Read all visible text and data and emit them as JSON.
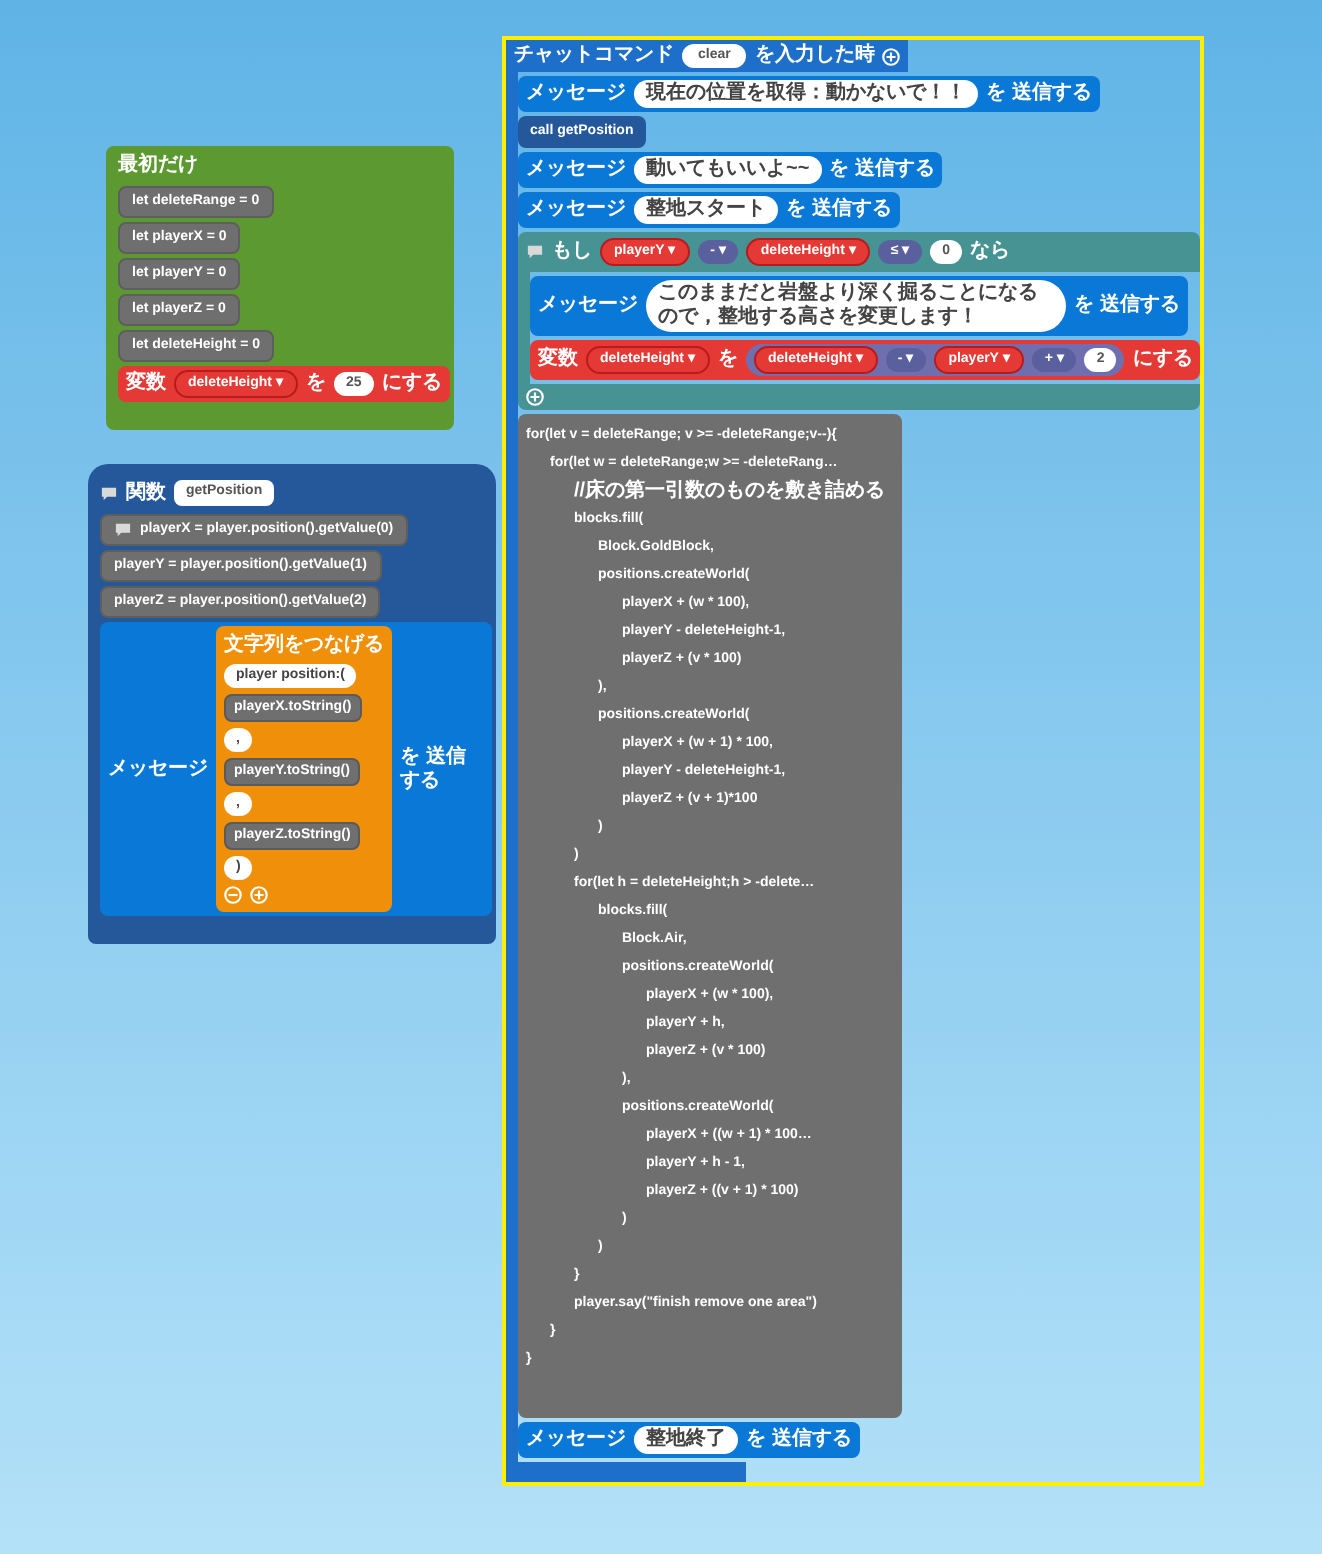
{
  "on_start": {
    "title": "最初だけ",
    "statements": [
      {
        "kind": "js",
        "text": "let deleteRange = 0",
        "comment": false
      },
      {
        "kind": "js",
        "text": "let playerX = 0",
        "comment": false
      },
      {
        "kind": "js",
        "text": "let playerY = 0",
        "comment": false
      },
      {
        "kind": "js",
        "text": "let playerZ = 0",
        "comment": false
      },
      {
        "kind": "js",
        "text": "let deleteHeight = 0",
        "comment": false
      },
      {
        "kind": "set",
        "label": "変数",
        "variable": "deleteHeight ▾",
        "to": "を",
        "value": {
          "kind": "num",
          "text": "25"
        },
        "suffix": "にする"
      }
    ]
  },
  "function": {
    "label": "関数",
    "name": "getPosition",
    "statements": [
      {
        "kind": "js",
        "text": "playerX = player.position().getValue(0)",
        "comment": true
      },
      {
        "kind": "js",
        "text": "playerY = player.position().getValue(1)",
        "comment": false
      },
      {
        "kind": "js",
        "text": "playerZ = player.position().getValue(2)",
        "comment": false
      },
      {
        "kind": "message",
        "label": "メッセージ",
        "value": {
          "kind": "join",
          "title": "文字列をつなげる",
          "items": [
            {
              "kind": "text",
              "text": "player position:("
            },
            {
              "kind": "code",
              "text": "playerX.toString()"
            },
            {
              "kind": "text",
              "text": ","
            },
            {
              "kind": "code",
              "text": "playerY.toString()"
            },
            {
              "kind": "text",
              "text": ","
            },
            {
              "kind": "code",
              "text": "playerZ.toString()"
            },
            {
              "kind": "text",
              "text": ")"
            }
          ]
        },
        "suffix": "を 送信する"
      }
    ]
  },
  "chat_command": {
    "selected": true,
    "label": "チャットコマンド",
    "command": "clear",
    "suffix": "を入力した時",
    "statements": [
      {
        "kind": "message",
        "label": "メッセージ",
        "value": {
          "kind": "text",
          "text": "現在の位置を取得：動かないで！！"
        },
        "suffix": "を 送信する"
      },
      {
        "kind": "call",
        "text": "call getPosition"
      },
      {
        "kind": "message",
        "label": "メッセージ",
        "value": {
          "kind": "text",
          "text": "動いてもいいよ~~"
        },
        "suffix": "を 送信する"
      },
      {
        "kind": "message",
        "label": "メッセージ",
        "value": {
          "kind": "text",
          "text": "整地スタート"
        },
        "suffix": "を 送信する"
      },
      {
        "kind": "if",
        "label": "もし",
        "condition": [
          {
            "kind": "var",
            "text": "playerY ▾"
          },
          {
            "kind": "op",
            "text": "- ▾"
          },
          {
            "kind": "var",
            "text": "deleteHeight ▾"
          },
          {
            "kind": "op",
            "text": "≤ ▾"
          },
          {
            "kind": "num",
            "text": "0"
          }
        ],
        "then": "なら",
        "body": [
          {
            "kind": "message",
            "label": "メッセージ",
            "value": {
              "kind": "text",
              "text": "このままだと岩盤より深く掘ることになるので，整地する高さを変更します！"
            },
            "suffix": "を 送信する"
          },
          {
            "kind": "set",
            "label": "変数",
            "variable": "deleteHeight ▾",
            "to": "を",
            "value": {
              "kind": "expression",
              "parts": [
                {
                  "kind": "var",
                  "text": "deleteHeight ▾"
                },
                {
                  "kind": "op",
                  "text": "- ▾"
                },
                {
                  "kind": "var",
                  "text": "playerY ▾"
                },
                {
                  "kind": "op",
                  "text": "+ ▾"
                },
                {
                  "kind": "num",
                  "text": "2"
                }
              ]
            },
            "suffix": "にする"
          }
        ]
      },
      {
        "kind": "code",
        "lines": [
          {
            "text": "for(let v = deleteRange; v >= -deleteRange;v--){",
            "children": [
              {
                "text": "for(let w = deleteRange;w >= -deleteRang…",
                "children": [
                  {
                    "kind": "comment",
                    "text": "//床の第一引数のものを敷き詰める"
                  },
                  {
                    "text": "blocks.fill(",
                    "children": [
                      {
                        "text": "Block.GoldBlock,"
                      },
                      {
                        "text": "positions.createWorld(",
                        "children": [
                          {
                            "text": "playerX + (w * 100),"
                          },
                          {
                            "text": "playerY - deleteHeight-1,"
                          },
                          {
                            "text": "playerZ + (v * 100)"
                          }
                        ]
                      },
                      {
                        "text": "),"
                      },
                      {
                        "text": "positions.createWorld(",
                        "children": [
                          {
                            "text": "playerX + (w + 1) * 100,"
                          },
                          {
                            "text": "playerY - deleteHeight-1,"
                          },
                          {
                            "text": "playerZ + (v + 1)*100"
                          }
                        ]
                      },
                      {
                        "text": ")"
                      }
                    ]
                  },
                  {
                    "text": ")"
                  },
                  {
                    "text": "for(let h = deleteHeight;h > -delete…",
                    "children": [
                      {
                        "text": "blocks.fill(",
                        "children": [
                          {
                            "text": "Block.Air,"
                          },
                          {
                            "text": "positions.createWorld(",
                            "children": [
                              {
                                "text": "playerX + (w * 100),"
                              },
                              {
                                "text": "playerY +  h,"
                              },
                              {
                                "text": "playerZ + (v * 100)"
                              }
                            ]
                          },
                          {
                            "text": "),"
                          },
                          {
                            "text": "positions.createWorld(",
                            "children": [
                              {
                                "text": "playerX + ((w + 1) * 100…"
                              },
                              {
                                "text": "playerY + h - 1,"
                              },
                              {
                                "text": "playerZ + ((v + 1) * 100)"
                              }
                            ]
                          },
                          {
                            "text": ")"
                          }
                        ]
                      },
                      {
                        "text": ")"
                      }
                    ]
                  },
                  {
                    "text": "}"
                  },
                  {
                    "text": "player.say(\"finish remove one area\")"
                  }
                ]
              },
              {
                "text": "}"
              }
            ]
          },
          {
            "text": "}"
          }
        ]
      },
      {
        "kind": "message",
        "label": "メッセージ",
        "value": {
          "kind": "text",
          "text": "整地終了"
        },
        "suffix": "を 送信する"
      }
    ]
  }
}
